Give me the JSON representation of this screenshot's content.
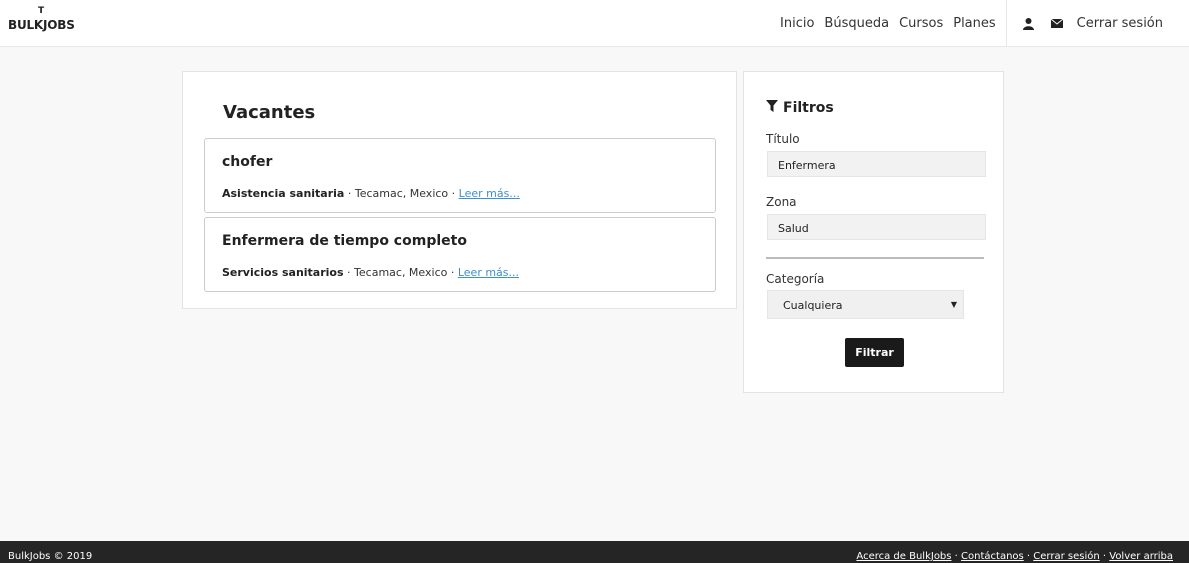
{
  "brand": {
    "logo_text": "BULKJOBS"
  },
  "nav": {
    "links": [
      "Inicio",
      "Búsqueda",
      "Cursos",
      "Planes"
    ],
    "user_icon": "user-icon",
    "mail_icon": "envelope-icon",
    "logout": "Cerrar sesión"
  },
  "vacantes": {
    "title": "Vacantes",
    "jobs": [
      {
        "title": "chofer",
        "category": "Asistencia sanitaria",
        "location": "Tecamac, Mexico",
        "more": "Leer más..."
      },
      {
        "title": "Enfermera de tiempo completo",
        "category": "Servicios sanitarios",
        "location": "Tecamac, Mexico",
        "more": "Leer más..."
      }
    ]
  },
  "filtros": {
    "title": "Filtros",
    "icon": "filter-icon",
    "titulo_label": "Título",
    "titulo_value": "Enfermera",
    "zona_label": "Zona",
    "zona_value": "Salud",
    "categoria_label": "Categoría",
    "categoria_value": "Cualquiera",
    "button": "Filtrar"
  },
  "footer": {
    "copyright": "BulkJobs © 2019",
    "links": [
      "Acerca de BulkJobs",
      "Contáctanos",
      "Cerrar sesión",
      "Volver arriba"
    ]
  }
}
